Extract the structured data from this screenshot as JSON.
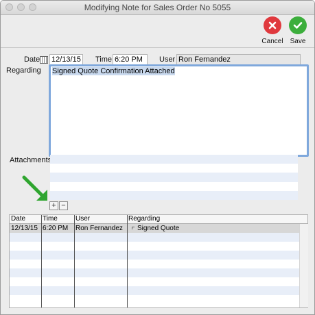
{
  "window": {
    "title": "Modifying Note for Sales Order No 5055"
  },
  "toolbar": {
    "cancel_label": "Cancel",
    "save_label": "Save",
    "cancel_color": "#e0393e",
    "save_color": "#3cae3c"
  },
  "form": {
    "date_label": "Date",
    "date_value": "12/13/15",
    "time_label": "Time",
    "time_value": "6:20 PM",
    "user_label": "User",
    "user_value": "Ron Fernandez",
    "regarding_label": "Regarding",
    "regarding_value": "Signed Quote Confirmation Attached",
    "attachments_label": "Attachments"
  },
  "attachment_controls": {
    "add_label": "+",
    "remove_label": "−"
  },
  "notes_table": {
    "columns": [
      "Date",
      "Time",
      "User",
      "Regarding"
    ],
    "rows": [
      {
        "date": "12/13/15",
        "time": "6:20 PM",
        "user": "Ron Fernandez",
        "regarding": "Signed Quote"
      }
    ]
  }
}
